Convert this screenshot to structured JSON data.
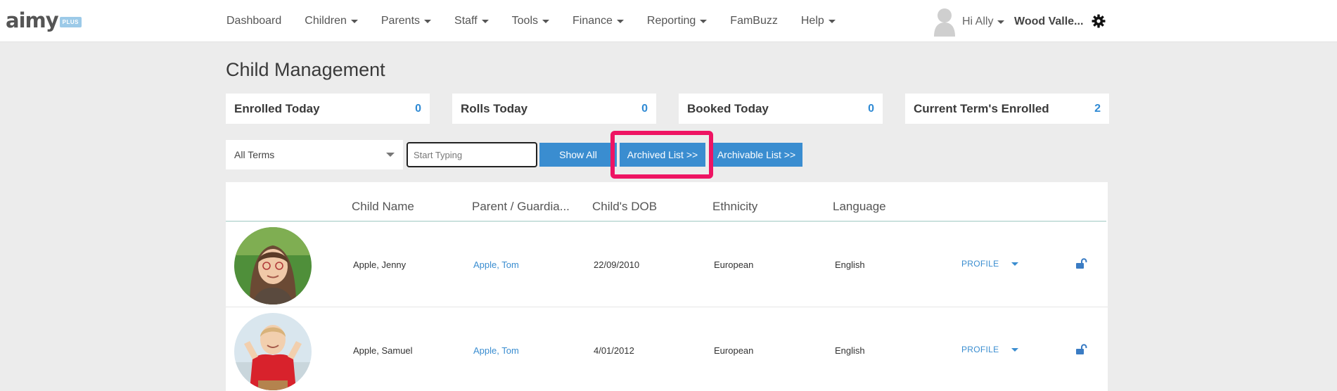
{
  "logo": {
    "text": "aimy",
    "badge": "PLUS"
  },
  "nav": {
    "items": [
      {
        "label": "Dashboard",
        "dropdown": false
      },
      {
        "label": "Children",
        "dropdown": true
      },
      {
        "label": "Parents",
        "dropdown": true
      },
      {
        "label": "Staff",
        "dropdown": true
      },
      {
        "label": "Tools",
        "dropdown": true
      },
      {
        "label": "Finance",
        "dropdown": true
      },
      {
        "label": "Reporting",
        "dropdown": true
      },
      {
        "label": "FamBuzz",
        "dropdown": false
      },
      {
        "label": "Help",
        "dropdown": true
      }
    ],
    "user_greeting": "Hi Ally",
    "org_name": "Wood Valle..."
  },
  "page_title": "Child Management",
  "stats": [
    {
      "label": "Enrolled Today",
      "value": "0"
    },
    {
      "label": "Rolls Today",
      "value": "0"
    },
    {
      "label": "Booked Today",
      "value": "0"
    },
    {
      "label": "Current Term's Enrolled",
      "value": "2"
    }
  ],
  "filters": {
    "term_selected": "All Terms",
    "search_placeholder": "Start Typing",
    "show_all_label": "Show All",
    "archived_label": "Archived List >>",
    "archivable_label": "Archivable List >>"
  },
  "table": {
    "headers": [
      "Child Name",
      "Parent / Guardia...",
      "Child's DOB",
      "Ethnicity",
      "Language"
    ],
    "profile_label": "PROFILE",
    "rows": [
      {
        "name": "Apple, Jenny",
        "parent": "Apple, Tom",
        "dob": "22/09/2010",
        "ethnicity": "European",
        "language": "English"
      },
      {
        "name": "Apple, Samuel",
        "parent": "Apple, Tom",
        "dob": "4/01/2012",
        "ethnicity": "European",
        "language": "English"
      }
    ]
  },
  "colors": {
    "accent": "#3a8dd0",
    "highlight": "#ee1463",
    "background": "#ececec"
  }
}
